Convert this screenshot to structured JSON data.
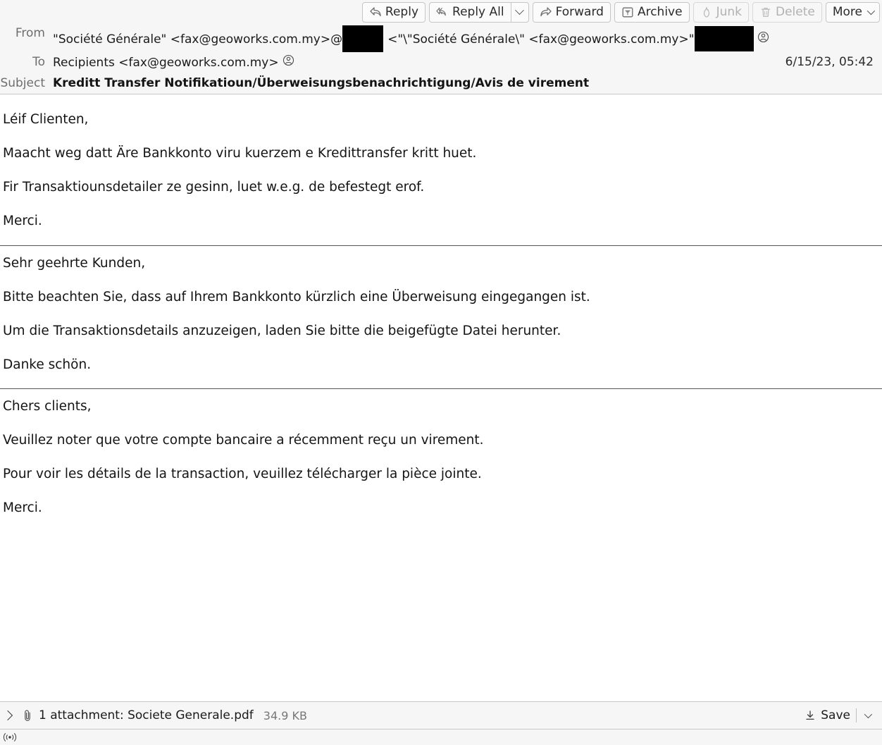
{
  "toolbar": {
    "reply": "Reply",
    "reply_all": "Reply All",
    "forward": "Forward",
    "archive": "Archive",
    "junk": "Junk",
    "delete": "Delete",
    "more": "More"
  },
  "header": {
    "from_label": "From",
    "from_value_part1": "\"Société Générale\" <fax@geoworks.com.my>@",
    "from_value_part2": "<\"\\\"Société Générale\\\" <fax@geoworks.com.my>\"",
    "to_label": "To",
    "to_value": "Recipients <fax@geoworks.com.my>",
    "subject_label": "Subject",
    "subject_value": "Kreditt Transfer Notifikatioun/Überweisungsbenachrichtigung/Avis de virement",
    "date": "6/15/23, 05:42"
  },
  "body": {
    "blocks": [
      {
        "lines": [
          "Léif Clienten,",
          "Maacht weg datt Äre Bankkonto viru kuerzem e Kredittransfer kritt huet.",
          "Fir Transaktiounsdetailer ze gesinn, luet w.e.g. de befestegt erof.",
          "Merci."
        ]
      },
      {
        "lines": [
          "Sehr geehrte Kunden,",
          "Bitte beachten Sie, dass auf Ihrem Bankkonto kürzlich eine Überweisung eingegangen ist.",
          "Um die Transaktionsdetails anzuzeigen, laden Sie bitte die beigefügte Datei herunter.",
          "Danke schön."
        ]
      },
      {
        "lines": [
          "Chers clients,",
          "Veuillez noter que votre compte bancaire a récemment reçu un virement.",
          "Pour voir les détails de la transaction, veuillez télécharger la pièce jointe.",
          "Merci."
        ]
      }
    ]
  },
  "attachment": {
    "summary": "1 attachment: Societe Generale.pdf",
    "size": "34.9 KB",
    "save_label": "Save"
  },
  "colors": {
    "header_bg": "#f6f6f6",
    "body_bg": "#ffffff",
    "text": "#141414",
    "muted": "#6e6e6e",
    "redaction": "#000000",
    "separator": "#555555"
  }
}
